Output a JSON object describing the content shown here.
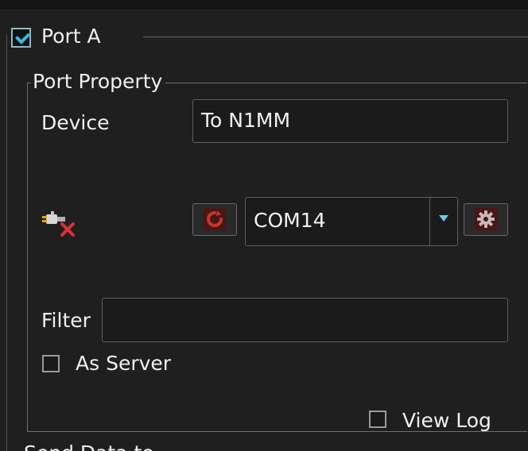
{
  "port_group": {
    "title": "Port A",
    "enabled": true
  },
  "port_property": {
    "legend": "Port Property",
    "device_label": "Device",
    "device_value": "To N1MM",
    "connection_icon": "plug-disconnected-icon",
    "refresh_icon": "refresh-icon",
    "com_port_value": "COM14",
    "dropdown_icon": "chevron-down-icon",
    "settings_icon": "gear-icon",
    "filter_label": "Filter",
    "filter_value": "",
    "as_server_label": "As Server",
    "as_server_checked": false,
    "view_log_label": "View Log",
    "view_log_checked": false
  },
  "next_section": {
    "title": "Send Data to"
  },
  "colors": {
    "background": "#1f1f1f",
    "accent": "#3fb6e0",
    "icon_red": "#c0392b"
  }
}
